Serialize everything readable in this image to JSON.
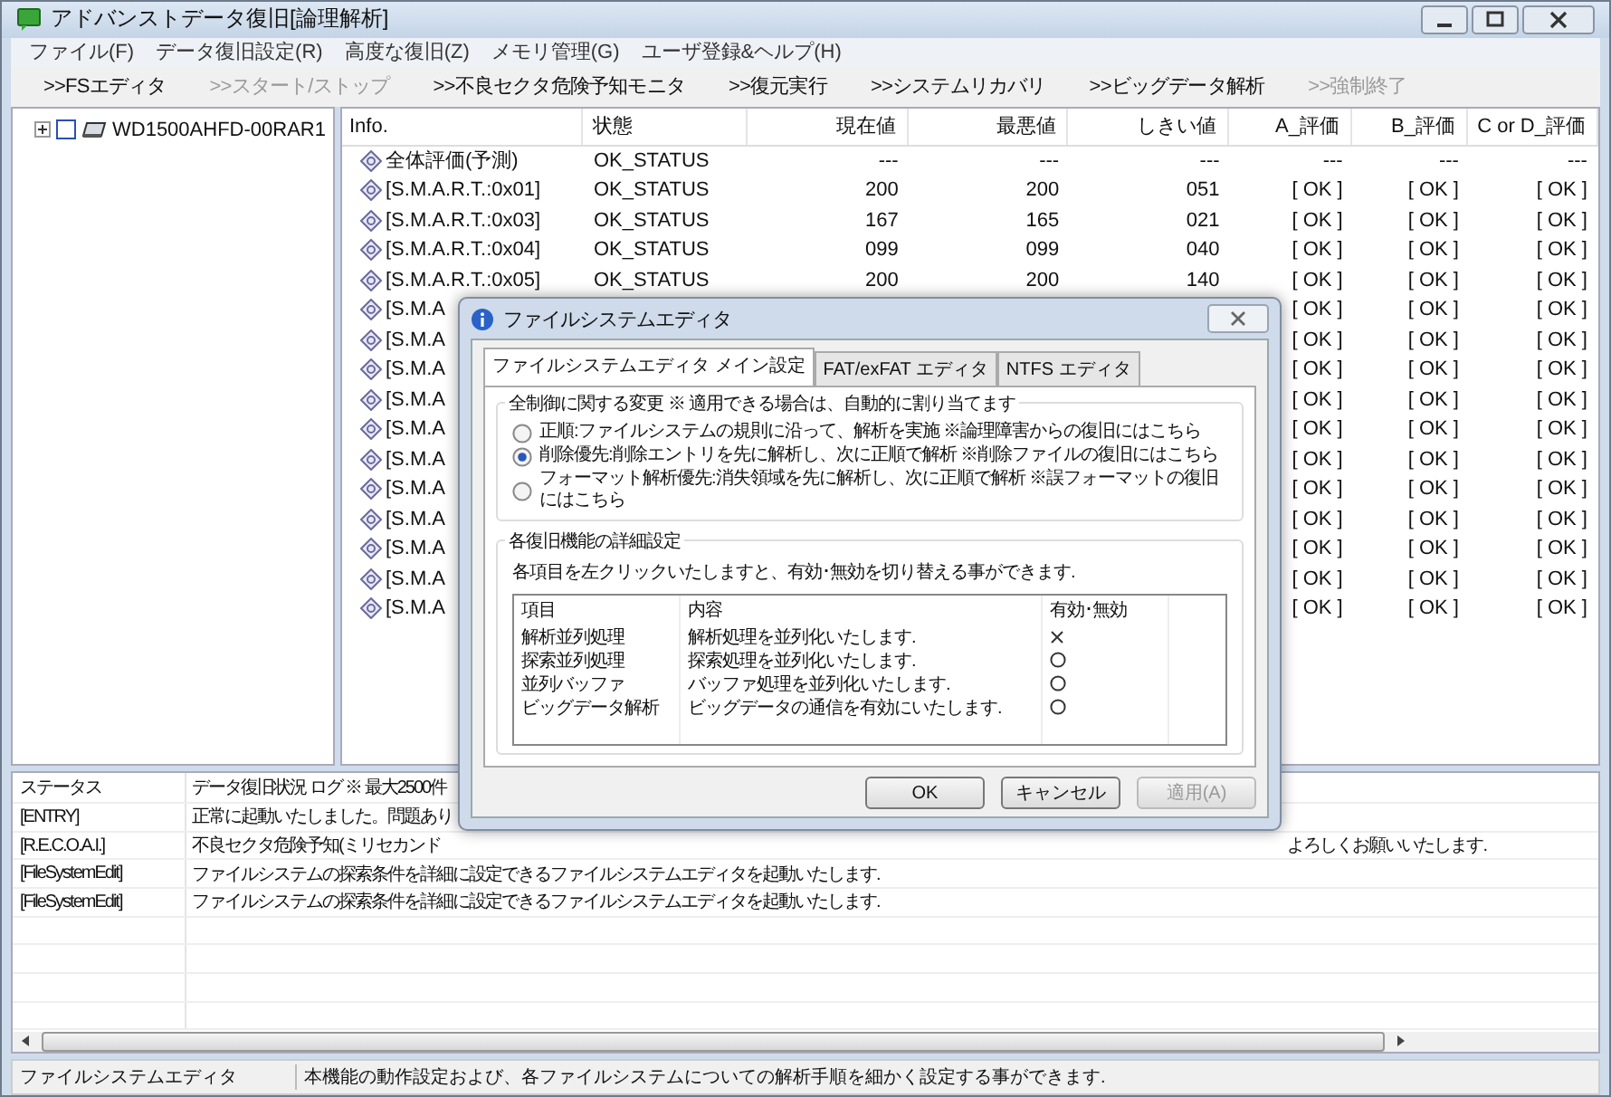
{
  "window": {
    "title": "アドバンストデータ復旧[論理解析]"
  },
  "menu": [
    "ファイル(F)",
    "データ復旧設定(R)",
    "高度な復旧(Z)",
    "メモリ管理(G)",
    "ユーザ登録&ヘルプ(H)"
  ],
  "toolbar": [
    {
      "label": ">>FSエディタ",
      "disabled": false
    },
    {
      "label": ">>スタート/ストップ",
      "disabled": true
    },
    {
      "label": ">>不良セクタ危険予知モニタ",
      "disabled": false
    },
    {
      "label": ">>復元実行",
      "disabled": false
    },
    {
      "label": ">>システムリカバリ",
      "disabled": false
    },
    {
      "label": ">>ビッグデータ解析",
      "disabled": false
    },
    {
      "label": ">>強制終了",
      "disabled": true
    }
  ],
  "tree": {
    "items": [
      {
        "label": "WD1500AHFD-00RAR1",
        "expanded": false,
        "checked": false
      }
    ]
  },
  "table": {
    "columns": [
      "Info.",
      "状態",
      "現在値",
      "最悪値",
      "しきい値",
      "A_評価",
      "B_評価",
      "C or D_評価"
    ],
    "rows": [
      {
        "info": "全体評価(予測)",
        "status": "OK_STATUS",
        "current": "---",
        "worst": "---",
        "threshold": "---",
        "a": "---",
        "b": "---",
        "c": "---"
      },
      {
        "info": "[S.M.A.R.T.:0x01]",
        "status": "OK_STATUS",
        "current": "200",
        "worst": "200",
        "threshold": "051",
        "a": "[ OK ]",
        "b": "[ OK ]",
        "c": "[ OK ]"
      },
      {
        "info": "[S.M.A.R.T.:0x03]",
        "status": "OK_STATUS",
        "current": "167",
        "worst": "165",
        "threshold": "021",
        "a": "[ OK ]",
        "b": "[ OK ]",
        "c": "[ OK ]"
      },
      {
        "info": "[S.M.A.R.T.:0x04]",
        "status": "OK_STATUS",
        "current": "099",
        "worst": "099",
        "threshold": "040",
        "a": "[ OK ]",
        "b": "[ OK ]",
        "c": "[ OK ]"
      },
      {
        "info": "[S.M.A.R.T.:0x05]",
        "status": "OK_STATUS",
        "current": "200",
        "worst": "200",
        "threshold": "140",
        "a": "[ OK ]",
        "b": "[ OK ]",
        "c": "[ OK ]"
      },
      {
        "info": "[S.M.A",
        "a": "[ OK ]",
        "b": "[ OK ]",
        "c": "[ OK ]"
      },
      {
        "info": "[S.M.A",
        "a": "[ OK ]",
        "b": "[ OK ]",
        "c": "[ OK ]"
      },
      {
        "info": "[S.M.A",
        "a": "[ OK ]",
        "b": "[ OK ]",
        "c": "[ OK ]"
      },
      {
        "info": "[S.M.A",
        "a": "[ OK ]",
        "b": "[ OK ]",
        "c": "[ OK ]"
      },
      {
        "info": "[S.M.A",
        "a": "[ OK ]",
        "b": "[ OK ]",
        "c": "[ OK ]"
      },
      {
        "info": "[S.M.A",
        "a": "[ OK ]",
        "b": "[ OK ]",
        "c": "[ OK ]"
      },
      {
        "info": "[S.M.A",
        "a": "[ OK ]",
        "b": "[ OK ]",
        "c": "[ OK ]"
      },
      {
        "info": "[S.M.A",
        "a": "[ OK ]",
        "b": "[ OK ]",
        "c": "[ OK ]"
      },
      {
        "info": "[S.M.A",
        "a": "[ OK ]",
        "b": "[ OK ]",
        "c": "[ OK ]"
      },
      {
        "info": "[S.M.A",
        "a": "[ OK ]",
        "b": "[ OK ]",
        "c": "[ OK ]"
      },
      {
        "info": "[S.M.A",
        "a": "[ OK ]",
        "b": "[ OK ]",
        "c": "[ OK ]"
      }
    ]
  },
  "log": {
    "columns": [
      "ステータス",
      "データ復旧状況 ログ ※ 最大2500件"
    ],
    "rows": [
      {
        "status": "[ENTRY]",
        "message": "正常に起動いたしました。問題あり"
      },
      {
        "status": "[R.E.C.O.A.I.]",
        "message": "不良セクタ危険予知(ミリセカンド",
        "message_tail": "よろしくお願いいたします."
      },
      {
        "status": "[FileSystemEdit]",
        "message": "ファイルシステムの探索条件を詳細に設定できるファイルシステムエディタを起動いたします."
      },
      {
        "status": "[FileSystemEdit]",
        "message": "ファイルシステムの探索条件を詳細に設定できるファイルシステムエディタを起動いたします."
      }
    ]
  },
  "status_bar": {
    "title": "ファイルシステムエディタ",
    "text": "本機能の動作設定および、各ファイルシステムについての解析手順を細かく設定する事ができます."
  },
  "dialog": {
    "title": "ファイルシステムエディタ",
    "tabs": [
      {
        "label": "ファイルシステムエディタ メイン設定",
        "selected": true
      },
      {
        "label": "FAT/exFAT エディタ",
        "selected": false
      },
      {
        "label": "NTFS エディタ",
        "selected": false
      }
    ],
    "group_1": {
      "title": "全制御に関する変更 ※ 適用できる場合は、自動的に割り当てます",
      "options": [
        {
          "label": "正順:ファイルシステムの規則に沿って、解析を実施 ※論理障害からの復旧にはこちら",
          "selected": false
        },
        {
          "label": "削除優先:削除エントリを先に解析し、次に正順で解析 ※削除ファイルの復旧にはこちら",
          "selected": true
        },
        {
          "label": "フォーマット解析優先:消失領域を先に解析し、次に正順で解析 ※誤フォーマットの復旧にはこちら",
          "selected": false
        }
      ]
    },
    "group_2": {
      "title": "各復旧機能の詳細設定",
      "hint": "各項目を左クリックいたしますと、有効･無効を切り替える事ができます.",
      "columns": [
        "項目",
        "内容",
        "有効･無効"
      ],
      "rows": [
        {
          "item": "解析並列処理",
          "content": "解析処理を並列化いたします.",
          "enabled": false
        },
        {
          "item": "探索並列処理",
          "content": "探索処理を並列化いたします.",
          "enabled": true
        },
        {
          "item": "並列バッファ",
          "content": "バッファ処理を並列化いたします.",
          "enabled": true
        },
        {
          "item": "ビッグデータ解析",
          "content": "ビッグデータの通信を有効にいたします.",
          "enabled": true
        }
      ]
    },
    "buttons": [
      {
        "label": "OK",
        "disabled": false
      },
      {
        "label": "キャンセル",
        "disabled": false
      },
      {
        "label": "適用(A)",
        "disabled": true
      }
    ]
  }
}
